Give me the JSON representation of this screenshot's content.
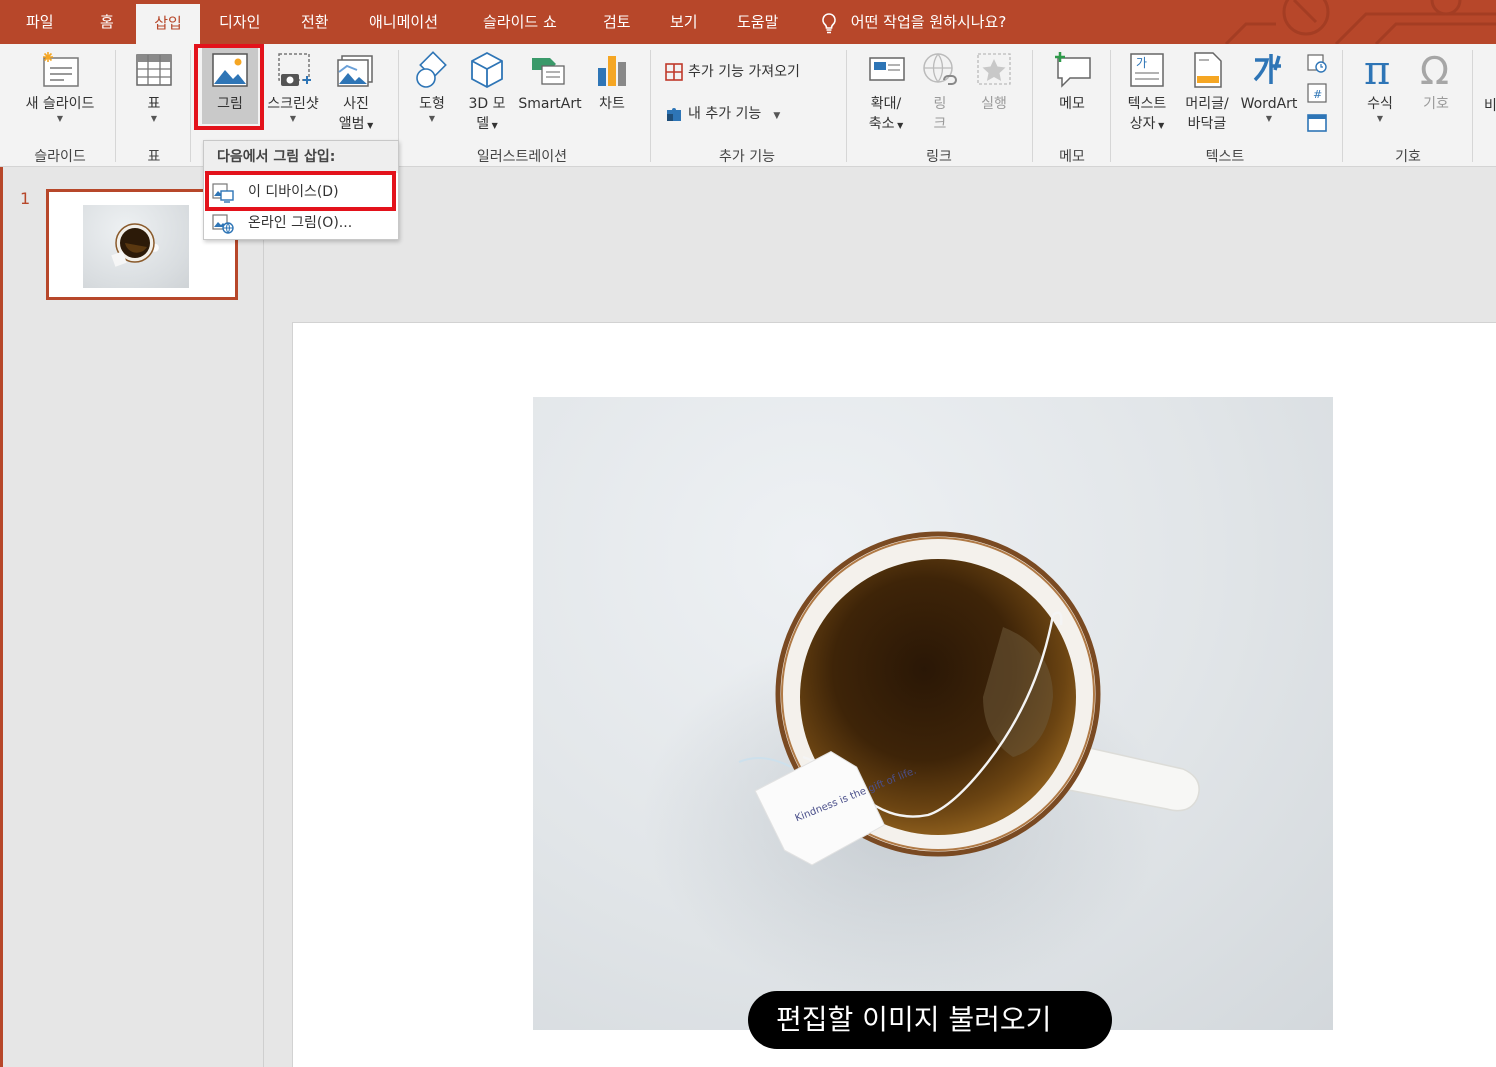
{
  "tabs": [
    {
      "label": "파일"
    },
    {
      "label": "홈"
    },
    {
      "label": "삽입"
    },
    {
      "label": "디자인"
    },
    {
      "label": "전환"
    },
    {
      "label": "애니메이션"
    },
    {
      "label": "슬라이드 쇼"
    },
    {
      "label": "검토"
    },
    {
      "label": "보기"
    },
    {
      "label": "도움말"
    }
  ],
  "tell_me": "어떤 작업을 원하시나요?",
  "ribbon": {
    "new_slide": "새 슬라이드",
    "table": "표",
    "picture": "그림",
    "screenshot": "스크린샷",
    "photo_album_1": "사진",
    "photo_album_2": "앨범",
    "shapes": "도형",
    "model3d_1": "3D 모",
    "model3d_2": "델",
    "smartart": "SmartArt",
    "chart": "차트",
    "get_addins": "추가 기능 가져오기",
    "my_addins": "내 추가 기능",
    "zoom_1": "확대/",
    "zoom_2": "축소",
    "link_1": "링",
    "link_2": "크",
    "action": "실행",
    "comment": "메모",
    "textbox_1": "텍스트",
    "textbox_2": "상자",
    "header_1": "머리글/",
    "header_2": "바닥글",
    "wordart": "WordArt",
    "equation": "수식",
    "symbol": "기호",
    "more": "비",
    "groups": {
      "slides": "슬라이드",
      "tables": "표",
      "illustrations": "일러스트레이션",
      "addins": "추가 기능",
      "links": "링크",
      "comments": "메모",
      "text": "텍스트",
      "symbols": "기호"
    }
  },
  "dropdown": {
    "header": "다음에서 그림 삽입:",
    "items": [
      {
        "label": "이 디바이스(D)"
      },
      {
        "label": "온라인 그림(O)..."
      }
    ]
  },
  "slides_pane": {
    "slide_number": "1"
  },
  "tea_tag": "Kindness is the gift of life.",
  "caption": "편집할 이미지 불러오기",
  "colors": {
    "accent": "#b7472a",
    "highlight": "#e3121b"
  }
}
